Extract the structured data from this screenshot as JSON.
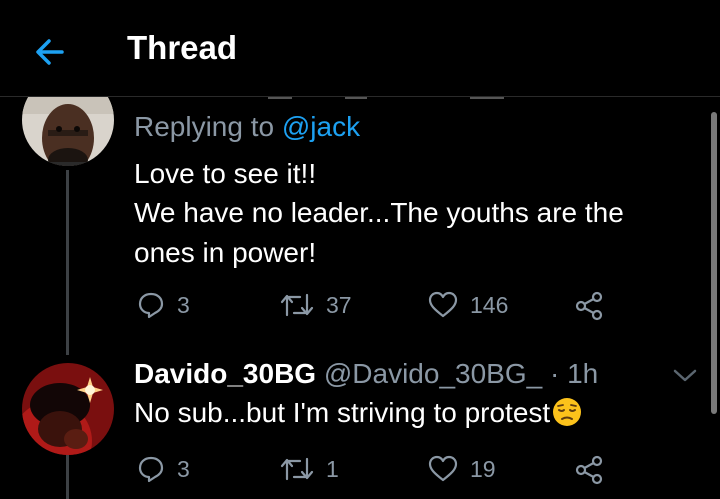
{
  "header": {
    "title": "Thread"
  },
  "tweet1": {
    "replying_prefix": "Replying to",
    "replying_handle": "@jack",
    "lines": [
      "Love to see it!!",
      "We have no leader...The youths are the",
      "ones in power!"
    ],
    "replies": "3",
    "retweets": "37",
    "likes": "146"
  },
  "tweet2": {
    "display_name": "Davido_30BG",
    "handle": "@Davido_30BG_",
    "time": "· 1h",
    "text": "No sub...but I'm striving to protest",
    "emoji": "pensive-face",
    "replies": "3",
    "retweets": "1",
    "likes": "19"
  },
  "colors": {
    "accent": "#1da1f2",
    "muted": "#8b98a5",
    "background": "#000000"
  }
}
